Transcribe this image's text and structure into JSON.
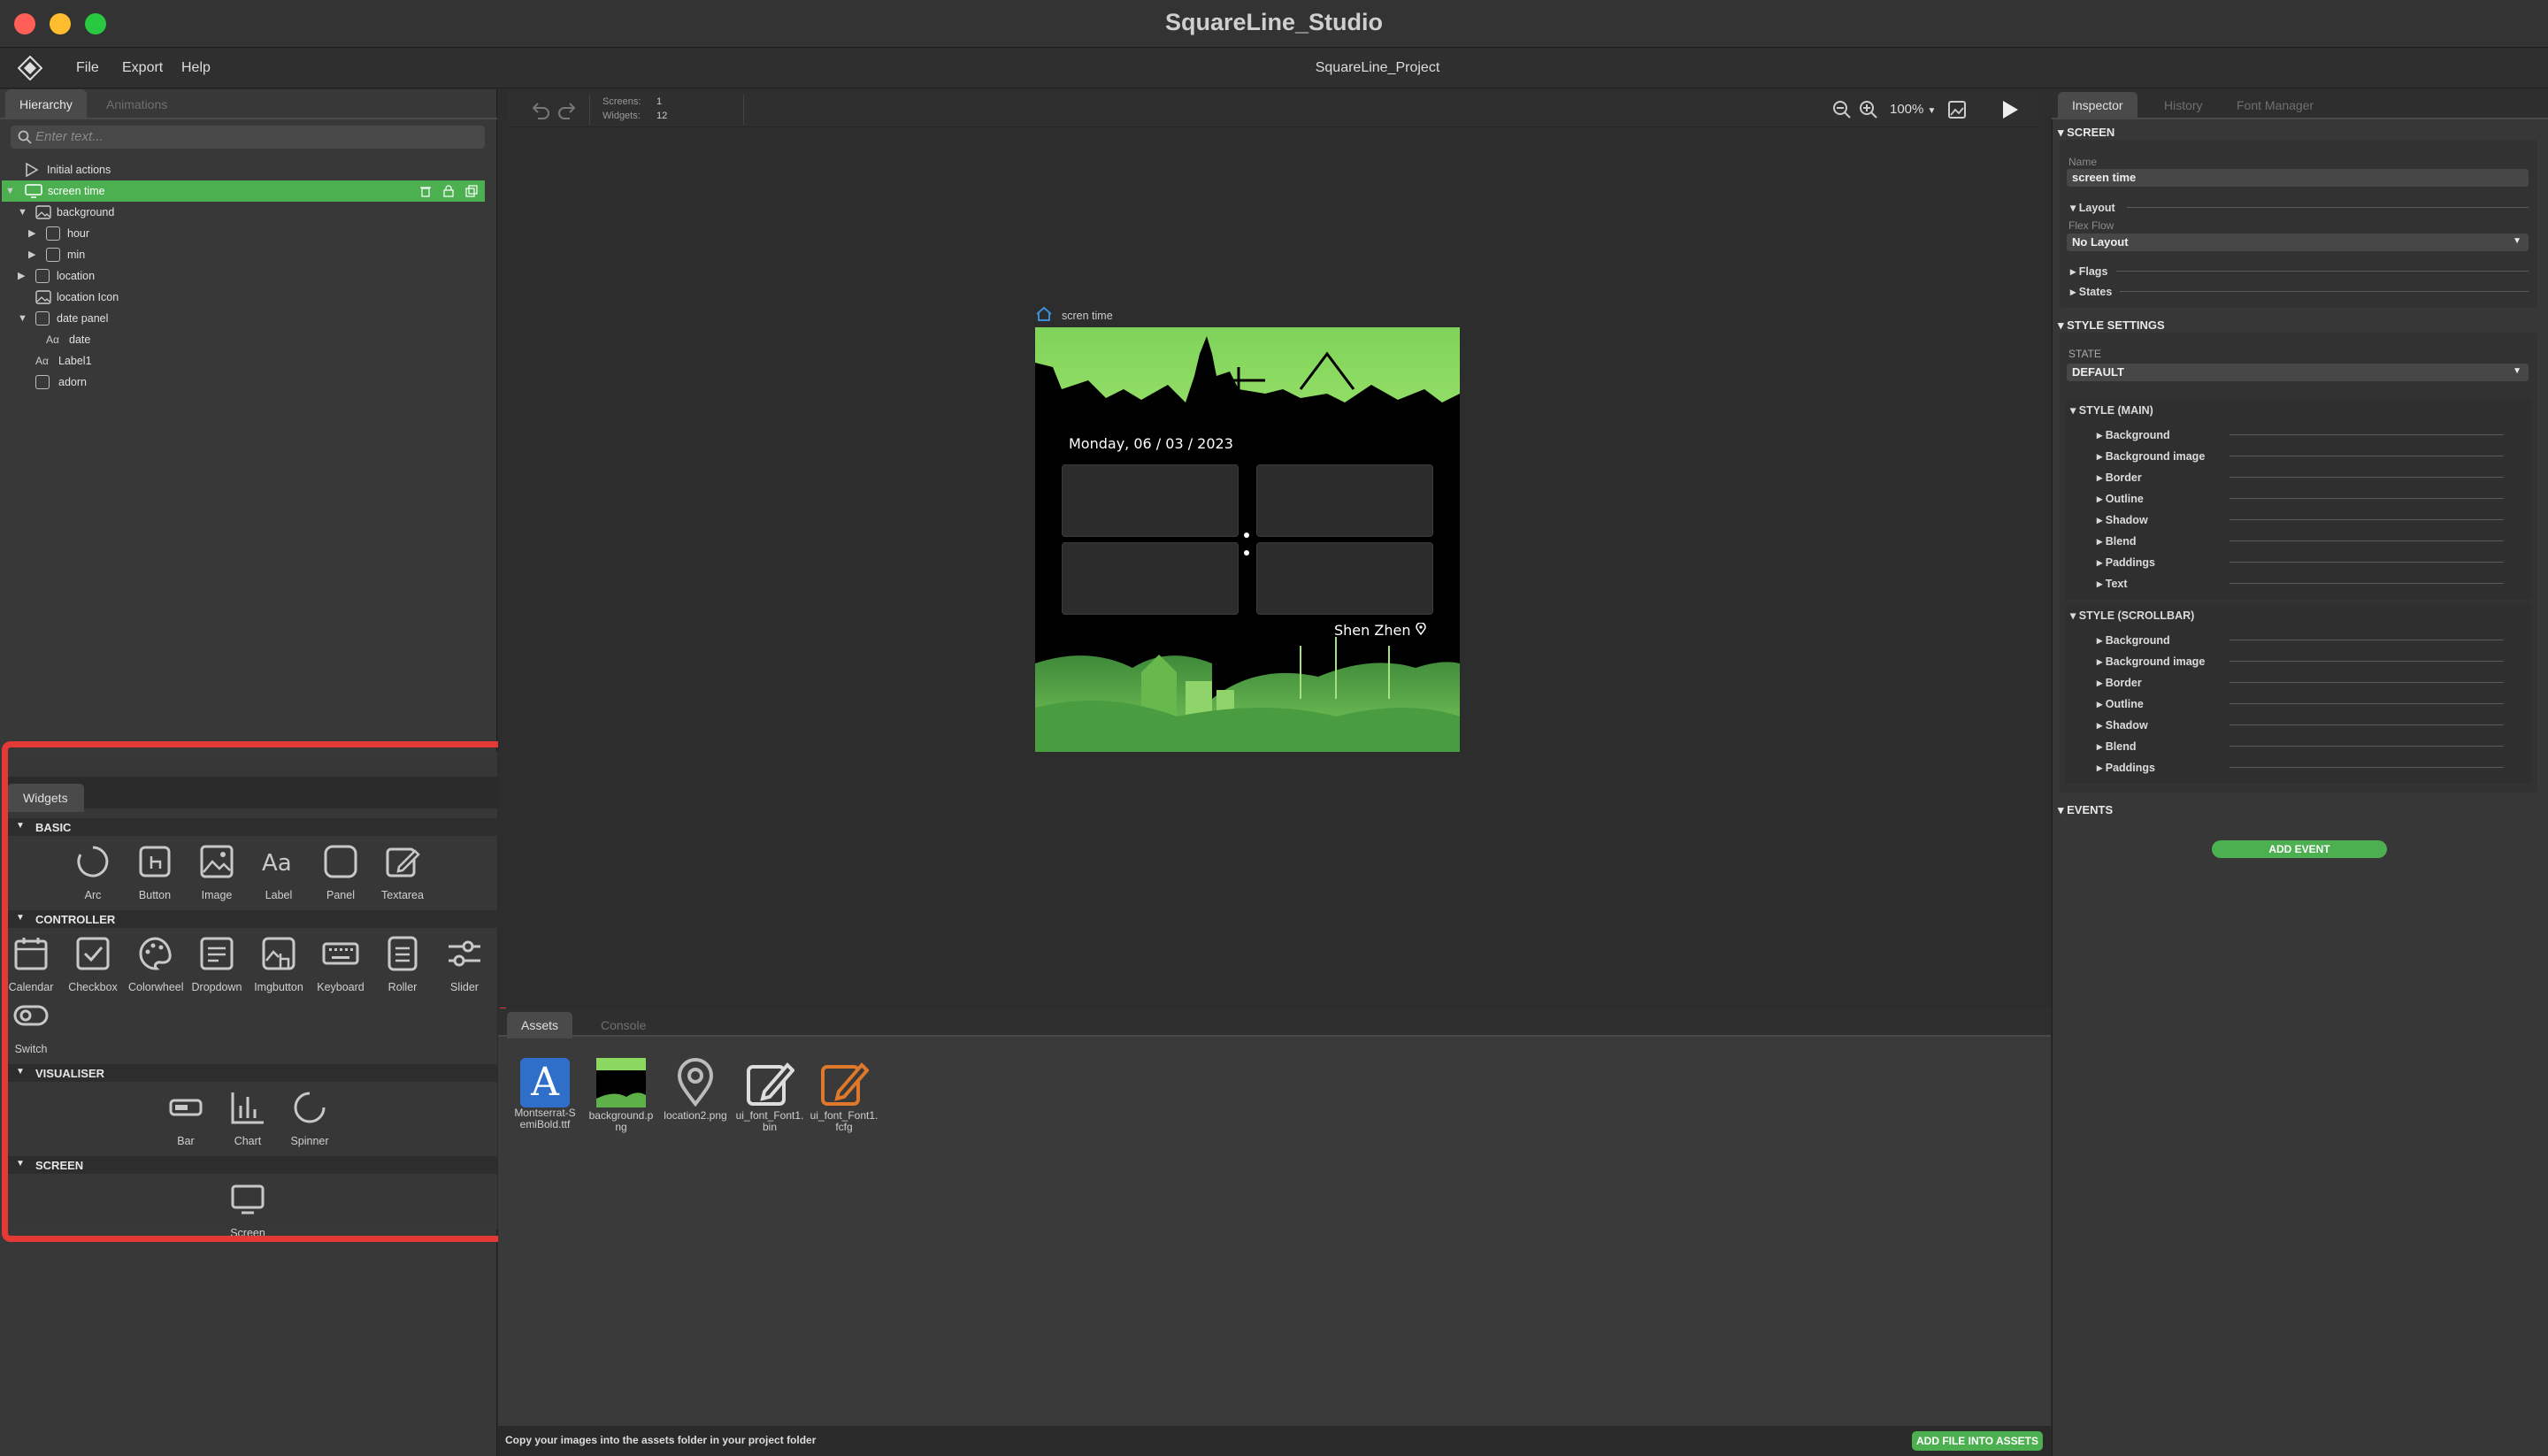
{
  "app": {
    "title": "SquareLine_Studio",
    "project": "SquareLine_Project"
  },
  "menu": {
    "items": [
      "File",
      "Export",
      "Help"
    ]
  },
  "left_tabs": {
    "hierarchy": "Hierarchy",
    "animations": "Animations"
  },
  "search": {
    "placeholder": "Enter text..."
  },
  "tree": {
    "initial_actions": "Initial actions",
    "screen": "screen time",
    "background": "background",
    "hour": "hour",
    "min": "min",
    "location": "location",
    "location_icon": "location Icon",
    "date_panel": "date panel",
    "date": "date",
    "label1": "Label1",
    "adorn": "adorn"
  },
  "widgets": {
    "tab": "Widgets",
    "basic": {
      "title": "BASIC",
      "items": [
        "Arc",
        "Button",
        "Image",
        "Label",
        "Panel",
        "Textarea"
      ]
    },
    "controller": {
      "title": "CONTROLLER",
      "items": [
        "Calendar",
        "Checkbox",
        "Colorwheel",
        "Dropdown",
        "Imgbutton",
        "Keyboard",
        "Roller",
        "Slider",
        "Switch"
      ]
    },
    "visualiser": {
      "title": "VISUALISER",
      "items": [
        "Bar",
        "Chart",
        "Spinner"
      ]
    },
    "screen": {
      "title": "SCREEN",
      "items": [
        "Screen"
      ]
    }
  },
  "toolbar": {
    "screens_label": "Screens:",
    "screens_value": "1",
    "widgets_label": "Widgets:",
    "widgets_value": "12",
    "zoom": "100%"
  },
  "canvas": {
    "screen_name": "scren time",
    "date_text": "Monday, 06 / 03 /  2023",
    "location_text": "Shen Zhen"
  },
  "assets": {
    "tabs": [
      "Assets",
      "Console"
    ],
    "files": [
      "Montserrat-SemiBold.ttf",
      "background.png",
      "location2.png",
      "ui_font_Font1.bin",
      "ui_font_Font1.fcfg"
    ],
    "file_labels": [
      [
        "Montserrat-S",
        "emiBold.ttf"
      ],
      [
        "background.p",
        "ng"
      ],
      [
        "location2.png",
        ""
      ],
      [
        "ui_font_Font1.",
        "bin"
      ],
      [
        "ui_font_Font1.",
        "fcfg"
      ]
    ],
    "hint": "Copy your images into the assets folder in your project folder",
    "add_button": "ADD FILE INTO ASSETS"
  },
  "inspector": {
    "tabs": [
      "Inspector",
      "History",
      "Font Manager"
    ],
    "screen_section": "SCREEN",
    "name_label": "Name",
    "name_value": "screen time",
    "layout": "Layout",
    "flex_flow_label": "Flex Flow",
    "flex_flow_value": "No Layout",
    "flags": "Flags",
    "states": "States",
    "style_settings": "STYLE SETTINGS",
    "state_label": "STATE",
    "state_value": "DEFAULT",
    "style_main": "STYLE (MAIN)",
    "style_main_items": [
      "Background",
      "Background image",
      "Border",
      "Outline",
      "Shadow",
      "Blend",
      "Paddings",
      "Text"
    ],
    "style_scrollbar": "STYLE (SCROLLBAR)",
    "style_scrollbar_items": [
      "Background",
      "Background image",
      "Border",
      "Outline",
      "Shadow",
      "Blend",
      "Paddings"
    ],
    "events": "EVENTS",
    "add_event": "ADD EVENT"
  },
  "colors": {
    "accent_green": "#4caf50",
    "highlight_red": "#e53935",
    "font_orange": "#e0782c"
  }
}
